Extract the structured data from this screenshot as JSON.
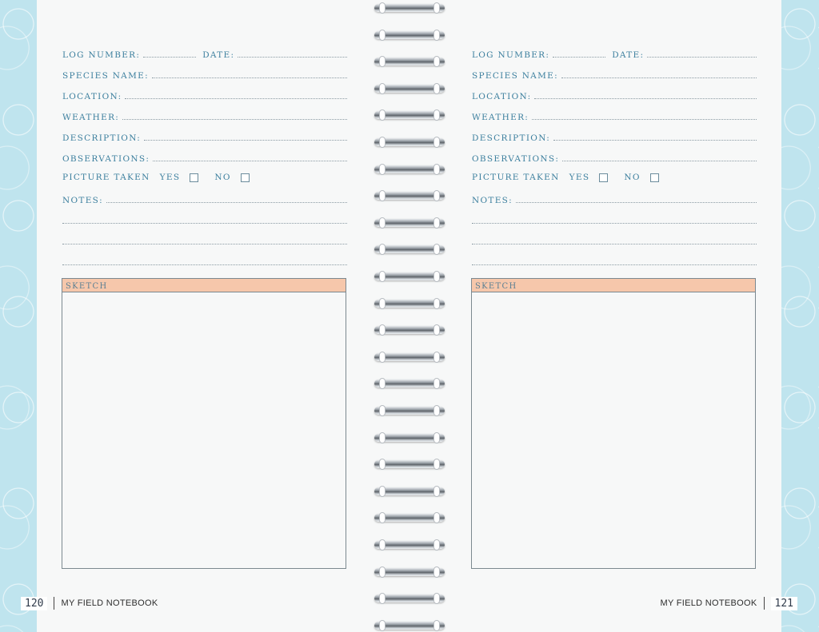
{
  "pages": [
    {
      "side": "left",
      "fields": {
        "log_number": "LOG NUMBER:",
        "date": "DATE:",
        "species_name": "SPECIES NAME:",
        "location": "LOCATION:",
        "weather": "WEATHER:",
        "description": "DESCRIPTION:",
        "observations": "OBSERVATIONS:",
        "picture_taken": "PICTURE TAKEN",
        "yes": "YES",
        "no": "NO",
        "notes": "NOTES:"
      },
      "sketch_label": "SKETCH",
      "page_number": "120",
      "footer_title": "MY FIELD NOTEBOOK"
    },
    {
      "side": "right",
      "fields": {
        "log_number": "LOG NUMBER:",
        "date": "DATE:",
        "species_name": "SPECIES NAME:",
        "location": "LOCATION:",
        "weather": "WEATHER:",
        "description": "DESCRIPTION:",
        "observations": "OBSERVATIONS:",
        "picture_taken": "PICTURE TAKEN",
        "yes": "YES",
        "no": "NO",
        "notes": "NOTES:"
      },
      "sketch_label": "SKETCH",
      "page_number": "121",
      "footer_title": "MY FIELD NOTEBOOK"
    }
  ],
  "colors": {
    "label": "#3c7f9e",
    "sketch_header": "#f6c7ab",
    "border_strip": "#bfe4ee"
  }
}
